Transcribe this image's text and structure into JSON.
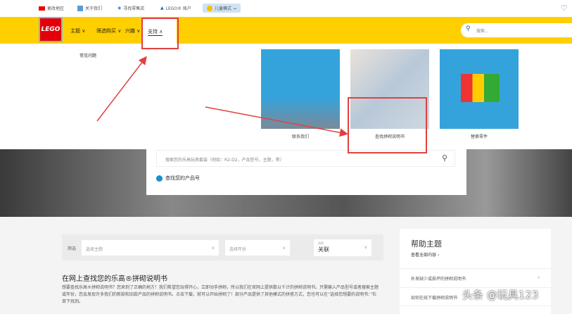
{
  "topbar": {
    "region": "更改地区",
    "about": "关于我们",
    "store": "寻找零售店",
    "lego_id": "LEGO® 账户",
    "kids_mode": "儿童模式 →"
  },
  "nav": {
    "logo": "LEGO",
    "items": [
      "主题 ∨",
      "筛选购买 ∨",
      "兴趣 ∨",
      "支持 ∧"
    ],
    "search_placeholder": "搜索..."
  },
  "mega": {
    "faq": "常见问题",
    "tiles": [
      "联系我们",
      "查找拼砌说明书",
      "替换零件"
    ]
  },
  "search_card": {
    "placeholder": "搜索您的乐高玩具套装（例如：R2-D2，产品型号，主题，等）",
    "find_product": "查找您的产品号"
  },
  "filter": {
    "label": "筛选",
    "theme": "选择主题",
    "year": "选择年份",
    "sort_label": "排序",
    "sort_value": "关联"
  },
  "intro": {
    "title": "在网上查找您的乐高®拼砌说明书",
    "body": "想要查找乐高®拼砌说明书？您来到了正确的地方！我们希望您玩得开心，立即动手拼砌，所以我们在官网上提供数以千计的拼砌说明书。只需输入产品型号或者搜索主题或年份，您会发现许多我们的新款和旧款产品的拼砌说明书。点击下载，就可以开始拼砌了！部分产品提供了其他模式的拼搭方式，您也可以在“选择您想要的说明书：”栏目下找到。"
  },
  "help": {
    "title": "帮助主题",
    "view_all": "查看全部内容 ›",
    "items": [
      "补发缺少或损坏的拼砌说明书",
      "如何在线下载拼砌说明书"
    ]
  },
  "watermark": "头条 @玩具123"
}
